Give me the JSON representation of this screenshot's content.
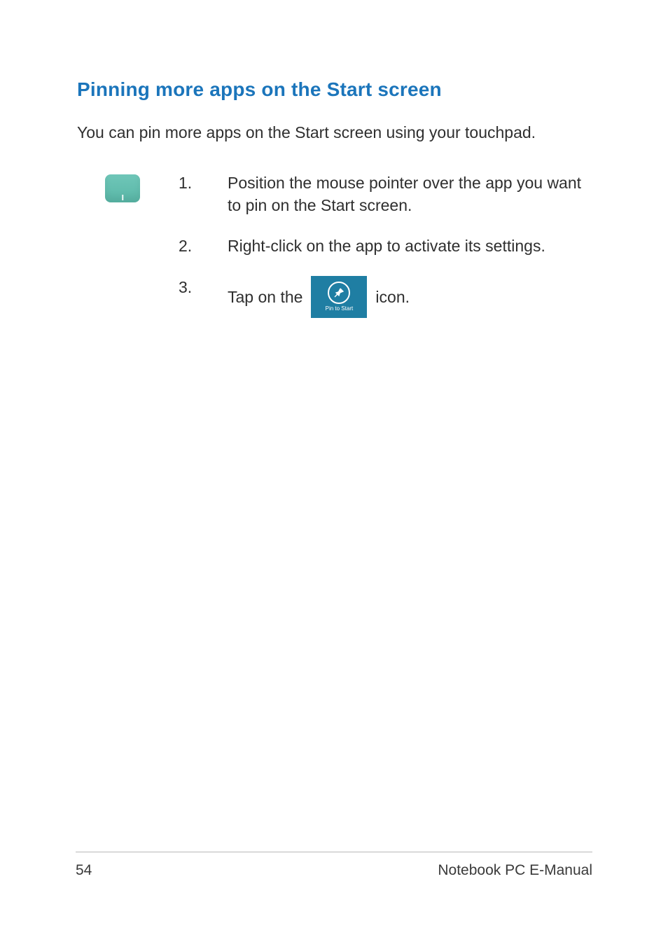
{
  "heading": "Pinning more apps on the Start screen",
  "intro": "You can pin more apps on the Start screen using your touchpad.",
  "steps": [
    {
      "num": "1.",
      "text": "Position the mouse pointer over the app you want to pin on the Start screen."
    },
    {
      "num": "2.",
      "text": "Right-click on the app to activate its settings."
    },
    {
      "num": "3.",
      "prefix": "Tap on the",
      "suffix": "icon."
    }
  ],
  "pin_icon_label": "Pin to Start",
  "footer": {
    "page_number": "54",
    "doc_title": "Notebook PC E-Manual"
  }
}
